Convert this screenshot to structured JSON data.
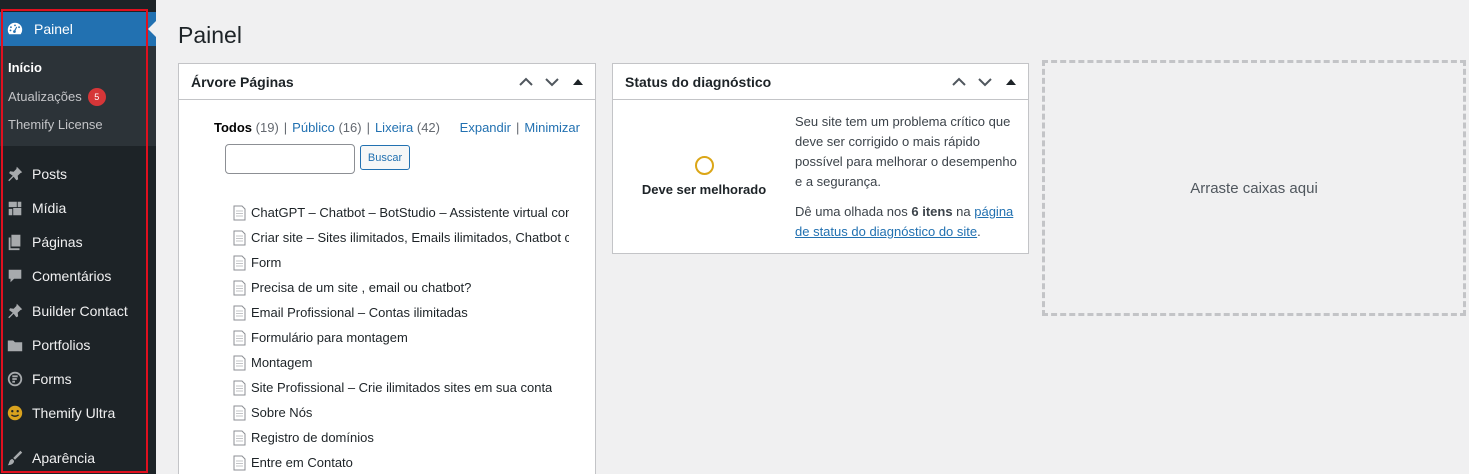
{
  "sidebar": {
    "dashboard_label": "Painel",
    "submenu": [
      {
        "label": "Início"
      },
      {
        "label": "Atualizações",
        "badge": "5"
      },
      {
        "label": "Themify License"
      }
    ],
    "items": [
      {
        "label": "Posts",
        "icon": "pin-icon"
      },
      {
        "label": "Mídia",
        "icon": "media-icon"
      },
      {
        "label": "Páginas",
        "icon": "pages-icon"
      },
      {
        "label": "Comentários",
        "icon": "comments-icon"
      },
      {
        "label": "Builder Contact",
        "icon": "pin-icon"
      },
      {
        "label": "Portfolios",
        "icon": "folder-icon"
      },
      {
        "label": "Forms",
        "icon": "forms-icon"
      },
      {
        "label": "Themify Ultra",
        "icon": "themify-icon"
      },
      {
        "label": "Aparência",
        "icon": "brush-icon"
      }
    ],
    "highlight_color": "#e0101f",
    "accent_color": "#2271b1"
  },
  "page": {
    "title": "Painel"
  },
  "tree_widget": {
    "title": "Árvore Páginas",
    "filters": {
      "all_label": "Todos",
      "all_count": "(19)",
      "public_label": "Público",
      "public_count": "(16)",
      "trash_label": "Lixeira",
      "trash_count": "(42)"
    },
    "expand_label": "Expandir",
    "collapse_label": "Minimizar",
    "search_value": "",
    "search_button": "Buscar",
    "pages": [
      "ChatGPT – Chatbot – BotStudio – Assistente virtual com",
      "Criar site – Sites ilimitados, Emails ilimitados, Chatbot co",
      "Form",
      "Precisa de um site , email ou chatbot?",
      "Email Profissional – Contas ilimitadas",
      "Formulário para montagem",
      "Montagem",
      "Site Profissional – Crie ilimitados sites em sua conta",
      "Sobre Nós",
      "Registro de domínios",
      "Entre em Contato"
    ]
  },
  "diagnostic_widget": {
    "title": "Status do diagnóstico",
    "state": "Deve ser melhorado",
    "state_color": "#dba617",
    "message": "Seu site tem um problema crítico que deve ser corrigido o mais rápido possível para melhorar o desempenho e a segurança.",
    "items_prefix": "Dê uma olhada nos ",
    "items_count": "6 itens",
    "items_mid": " na ",
    "items_link": "página de status do diagnóstico do site",
    "items_suffix": "."
  },
  "dropzone": {
    "label": "Arraste caixas aqui"
  }
}
